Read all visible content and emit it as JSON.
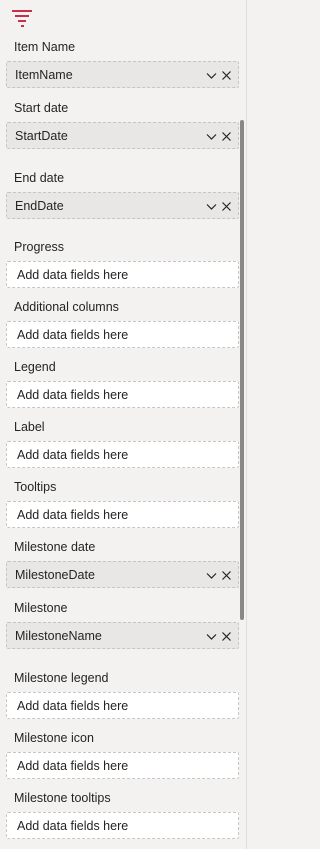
{
  "icons": {
    "build": "build-visual-icon",
    "chevron": "chevron-down-icon",
    "remove": "close-icon"
  },
  "colors": {
    "accent": "#c4314b"
  },
  "fields": [
    {
      "label": "Item Name",
      "value": "ItemName",
      "filled": true
    },
    {
      "label": "Start date",
      "value": "StartDate",
      "filled": true
    },
    {
      "label": "End date",
      "value": "EndDate",
      "filled": true
    },
    {
      "label": "Progress",
      "value": "Add data fields here",
      "filled": false
    },
    {
      "label": "Additional columns",
      "value": "Add data fields here",
      "filled": false
    },
    {
      "label": "Legend",
      "value": "Add data fields here",
      "filled": false
    },
    {
      "label": "Label",
      "value": "Add data fields here",
      "filled": false
    },
    {
      "label": "Tooltips",
      "value": "Add data fields here",
      "filled": false
    },
    {
      "label": "Milestone date",
      "value": "MilestoneDate",
      "filled": true
    },
    {
      "label": "Milestone",
      "value": "MilestoneName",
      "filled": true
    },
    {
      "label": "Milestone legend",
      "value": "Add data fields here",
      "filled": false
    },
    {
      "label": "Milestone icon",
      "value": "Add data fields here",
      "filled": false
    },
    {
      "label": "Milestone tooltips",
      "value": "Add data fields here",
      "filled": false
    }
  ]
}
